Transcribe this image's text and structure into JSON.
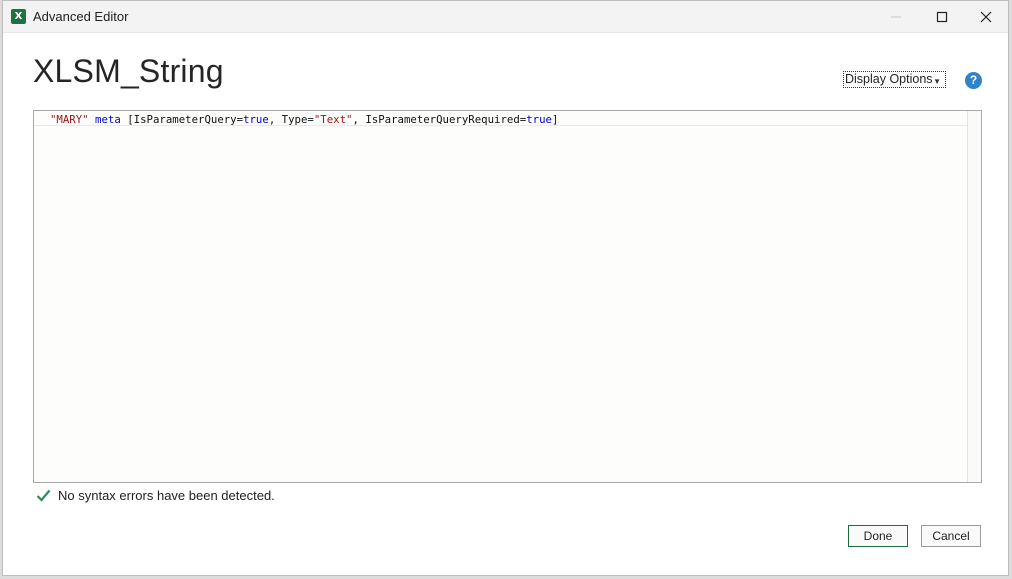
{
  "window": {
    "title": "Advanced Editor",
    "app_icon_letter": "X"
  },
  "header": {
    "query_name": "XLSM_String",
    "display_options_label": "Display Options",
    "help_symbol": "?"
  },
  "editor": {
    "line1": {
      "t1": "\"MARY\"",
      "t2": " ",
      "t3": "meta",
      "t4": " [IsParameterQuery=",
      "t5": "true",
      "t6": ", Type=",
      "t7": "\"Text\"",
      "t8": ", IsParameterQueryRequired=",
      "t9": "true",
      "t10": "]"
    }
  },
  "status": {
    "message": "No syntax errors have been detected."
  },
  "buttons": {
    "done": "Done",
    "cancel": "Cancel"
  },
  "colors": {
    "string": "#a31515",
    "keyword": "#0000cc",
    "app_green": "#1e7145",
    "check_green": "#2e8b57",
    "help_blue": "#2f83c6"
  }
}
